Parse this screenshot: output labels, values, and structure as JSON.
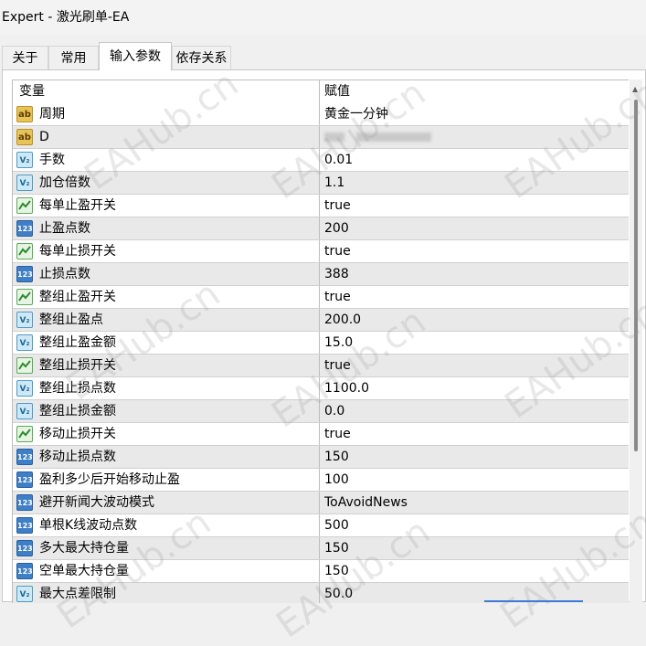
{
  "window": {
    "title": "Expert - 激光刷单-EA"
  },
  "tabs": [
    {
      "label": "关于",
      "active": false
    },
    {
      "label": "常用",
      "active": false
    },
    {
      "label": "输入参数",
      "active": true
    },
    {
      "label": "依存关系",
      "active": false
    }
  ],
  "table": {
    "col_variable": "变量",
    "col_value": "赋值",
    "rows": [
      {
        "type": "ab",
        "name": "周期",
        "value": "黄金一分钟"
      },
      {
        "type": "ab",
        "name": "D",
        "value": ""
      },
      {
        "type": "double",
        "name": "手数",
        "value": "0.01"
      },
      {
        "type": "double",
        "name": "加仓倍数",
        "value": "1.1"
      },
      {
        "type": "bool",
        "name": "每单止盈开关",
        "value": "true"
      },
      {
        "type": "int",
        "name": "止盈点数",
        "value": "200"
      },
      {
        "type": "bool",
        "name": "每单止损开关",
        "value": "true"
      },
      {
        "type": "int",
        "name": "止损点数",
        "value": "388"
      },
      {
        "type": "bool",
        "name": "整组止盈开关",
        "value": "true"
      },
      {
        "type": "double",
        "name": "整组止盈点",
        "value": "200.0"
      },
      {
        "type": "double",
        "name": "整组止盈金额",
        "value": "15.0"
      },
      {
        "type": "bool",
        "name": "整组止损开关",
        "value": "true"
      },
      {
        "type": "double",
        "name": "整组止损点数",
        "value": "1100.0"
      },
      {
        "type": "double",
        "name": "整组止损金额",
        "value": "0.0"
      },
      {
        "type": "bool",
        "name": "移动止损开关",
        "value": "true"
      },
      {
        "type": "int",
        "name": "移动止损点数",
        "value": "150"
      },
      {
        "type": "int",
        "name": "盈利多少后开始移动止盈",
        "value": "100"
      },
      {
        "type": "int",
        "name": "避开新闻大波动模式",
        "value": "ToAvoidNews"
      },
      {
        "type": "int",
        "name": "单根K线波动点数",
        "value": "500"
      },
      {
        "type": "int",
        "name": "多大最大持仓量",
        "value": "150"
      },
      {
        "type": "int",
        "name": "空单最大持仓量",
        "value": "150"
      },
      {
        "type": "double",
        "name": "最大点差限制",
        "value": "50.0"
      }
    ]
  },
  "icons": {
    "ab": {
      "text": "ab"
    },
    "double": {
      "text": "V₂"
    },
    "int": {
      "text": "123"
    },
    "bool": {
      "text": ""
    }
  },
  "watermark": {
    "text": "EAHub.cn"
  },
  "colors": {
    "row_alt": "#e9e9e9",
    "accent": "#3d7bd6"
  }
}
